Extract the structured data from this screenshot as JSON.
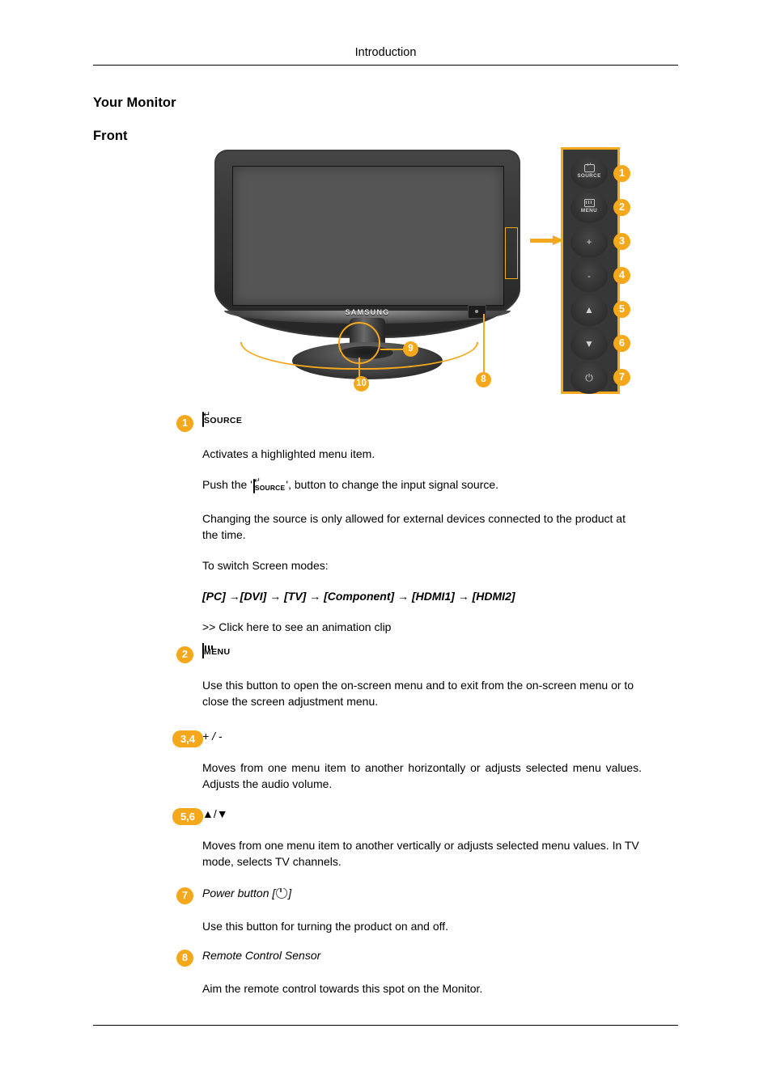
{
  "header": {
    "title": "Introduction"
  },
  "headings": {
    "your_monitor": "Your Monitor",
    "front": "Front"
  },
  "figure": {
    "brand_logo": "SAMSUNG",
    "callouts": [
      {
        "id": "8",
        "label": "8"
      },
      {
        "id": "9",
        "label": "9"
      },
      {
        "id": "10",
        "label": "10"
      }
    ],
    "panel_buttons": [
      {
        "badge": "1",
        "label": "SOURCE",
        "icon": "enter-arrow-icon"
      },
      {
        "badge": "2",
        "label": "MENU",
        "icon": "menu-bars-icon"
      },
      {
        "badge": "3",
        "label": "+",
        "icon": "plus-icon"
      },
      {
        "badge": "4",
        "label": "-",
        "icon": "minus-icon"
      },
      {
        "badge": "5",
        "label": "▲",
        "icon": "triangle-up-icon"
      },
      {
        "badge": "6",
        "label": "▼",
        "icon": "triangle-down-icon"
      },
      {
        "badge": "7",
        "label": "⏻",
        "icon": "power-icon"
      }
    ]
  },
  "items": [
    {
      "badge": "1",
      "head_icon_word": "SOURCE",
      "paragraphs": [
        "Activates a highlighted menu item.",
        "Push the '",
        "', button to change the input signal source.",
        "Changing the source is only allowed for external devices connected to the product at the time.",
        "To switch Screen modes:",
        "[PC] →[DVI] → [TV] → [Component] → [HDMI1] → [HDMI2]",
        ">> Click here to see an animation clip"
      ]
    },
    {
      "badge": "2",
      "head_icon_word": "MENU",
      "paragraphs": [
        "Use this button to open the on-screen menu and to exit from the on-screen menu or to close the screen adjustment menu."
      ]
    },
    {
      "badge": "3,4",
      "head_label": "+ / -",
      "paragraphs": [
        "Moves from one menu item to another horizontally or adjusts selected menu values. Adjusts the audio volume."
      ]
    },
    {
      "badge": "5,6",
      "head_label": "▲/▼",
      "paragraphs": [
        "Moves from one menu item to another vertically or adjusts selected menu values. In TV mode, selects TV channels."
      ]
    },
    {
      "badge": "7",
      "head_label_pre": "Power button [",
      "head_label_post": "]",
      "paragraphs": [
        "Use this button for turning the product on and off."
      ]
    },
    {
      "badge": "8",
      "head_label": "Remote Control Sensor",
      "paragraphs": [
        "Aim the remote control towards this spot on the Monitor."
      ]
    }
  ],
  "colors": {
    "accent": "#F5A81C",
    "bezel": "#343434",
    "screen": "#565656",
    "text": "#000000"
  }
}
